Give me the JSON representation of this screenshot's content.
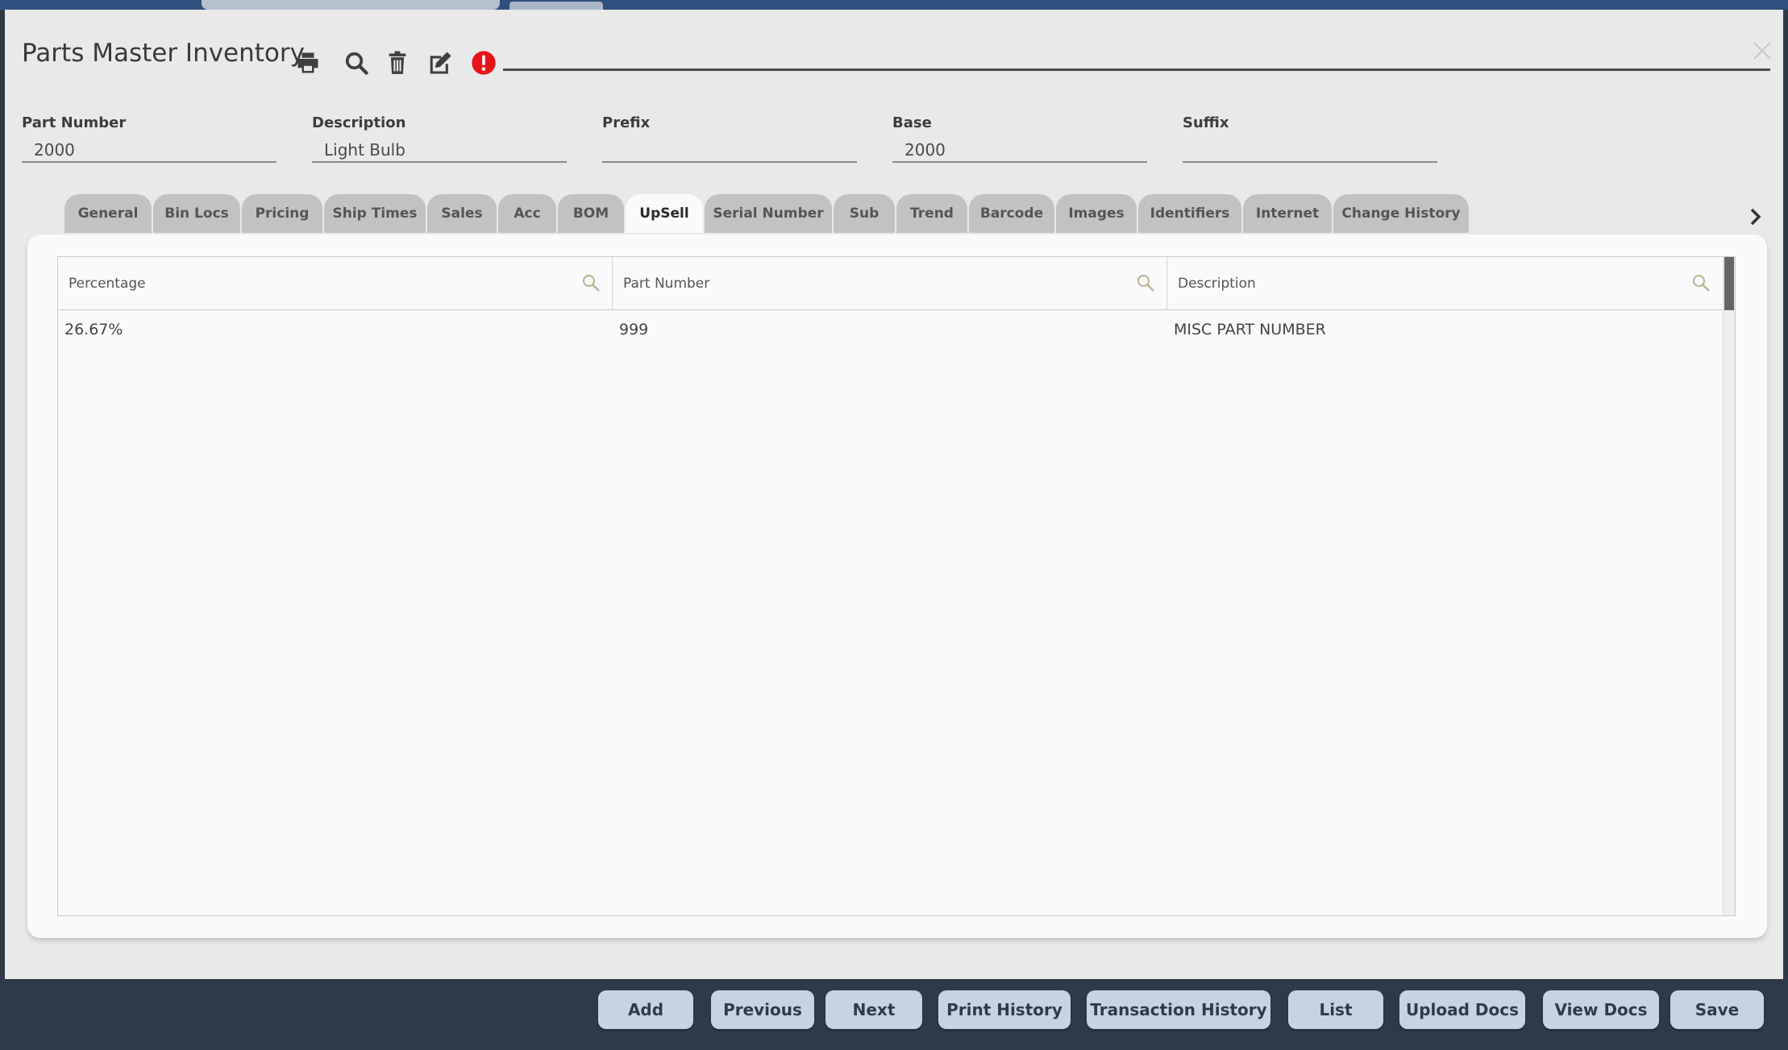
{
  "window": {
    "title": "Parts Master Inventory"
  },
  "toolbar": {
    "icons": [
      "print-icon",
      "search-icon",
      "trash-icon",
      "edit-icon",
      "alert-icon"
    ],
    "alert_color": "#e8141b"
  },
  "fields": {
    "part_number": {
      "label": "Part Number",
      "value": "2000"
    },
    "description": {
      "label": "Description",
      "value": "Light Bulb"
    },
    "prefix": {
      "label": "Prefix",
      "value": ""
    },
    "base": {
      "label": "Base",
      "value": "2000"
    },
    "suffix": {
      "label": "Suffix",
      "value": ""
    }
  },
  "tabs": [
    {
      "label": "General"
    },
    {
      "label": "Bin Locs"
    },
    {
      "label": "Pricing"
    },
    {
      "label": "Ship Times"
    },
    {
      "label": "Sales"
    },
    {
      "label": "Acc"
    },
    {
      "label": "BOM"
    },
    {
      "label": "UpSell",
      "active": true
    },
    {
      "label": "Serial Number"
    },
    {
      "label": "Sub"
    },
    {
      "label": "Trend"
    },
    {
      "label": "Barcode"
    },
    {
      "label": "Images"
    },
    {
      "label": "Identifiers"
    },
    {
      "label": "Internet"
    },
    {
      "label": "Change History"
    }
  ],
  "grid": {
    "columns": [
      "Percentage",
      "Part Number",
      "Description"
    ],
    "rows": [
      [
        "26.67%",
        "999",
        "MISC PART NUMBER"
      ]
    ]
  },
  "footer": {
    "buttons": [
      "Add",
      "Previous",
      "Next",
      "Print History",
      "Transaction History",
      "List",
      "Upload Docs",
      "View Docs",
      "Save"
    ]
  },
  "colors": {
    "header_bar": "#2d3a4a",
    "button_bg": "#c5d3e4",
    "search_icon": "#b7b48f"
  }
}
